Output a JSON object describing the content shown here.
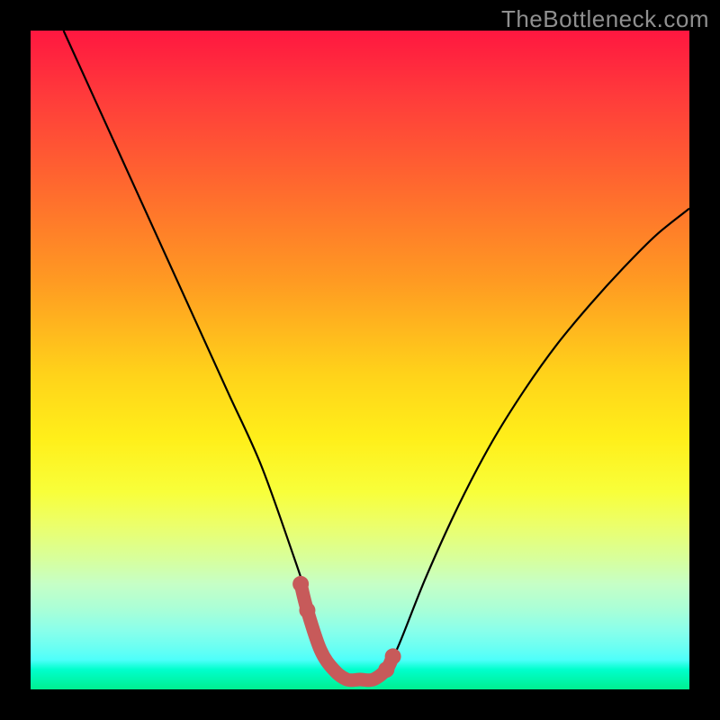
{
  "watermark": "TheBottleneck.com",
  "chart_data": {
    "type": "line",
    "title": "",
    "xlabel": "",
    "ylabel": "",
    "xlim": [
      0,
      100
    ],
    "ylim": [
      0,
      100
    ],
    "series": [
      {
        "name": "curve",
        "x": [
          5,
          10,
          15,
          20,
          25,
          30,
          35,
          40,
          42,
          44,
          46,
          48,
          50,
          52,
          54,
          56,
          60,
          65,
          70,
          75,
          80,
          85,
          90,
          95,
          100
        ],
        "values": [
          100,
          89,
          78,
          67,
          56,
          45,
          34,
          20,
          14,
          8,
          4,
          1.5,
          1.5,
          1.5,
          3,
          7,
          17,
          28,
          37.5,
          45.5,
          52.5,
          58.5,
          64,
          69,
          73
        ]
      },
      {
        "name": "highlight",
        "x": [
          41,
          42,
          44,
          46,
          48,
          50,
          52,
          54,
          55
        ],
        "values": [
          16,
          12,
          6,
          3,
          1.5,
          1.5,
          1.5,
          3,
          5
        ]
      }
    ],
    "highlight_color": "#c75a5a",
    "curve_color": "#000000"
  }
}
